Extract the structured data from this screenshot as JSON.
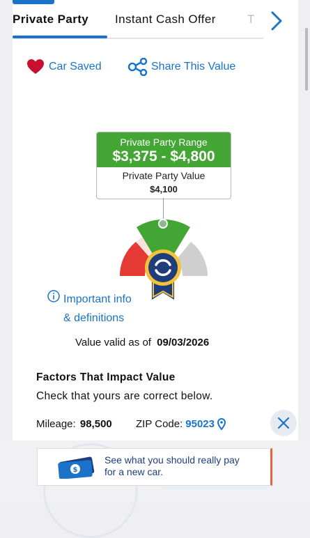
{
  "tabs": {
    "items": [
      "Private Party",
      "Instant Cash Offer",
      "T"
    ],
    "active": "Private Party"
  },
  "actions": {
    "saved_label": "Car Saved",
    "share_label": "Share This Value"
  },
  "range": {
    "title": "Private Party Range",
    "value": "$3,375 - $4,800",
    "sub_label": "Private Party Value",
    "sub_value": "$4,100"
  },
  "info": {
    "line1": "Important info",
    "line2": "& definitions"
  },
  "valid": {
    "label": "Value valid as of",
    "date": "09/03/2026"
  },
  "factors": {
    "title": "Factors That Impact Value",
    "subtitle": "Check that yours are correct below.",
    "mileage_label": "Mileage:",
    "mileage_value": "98,500",
    "zip_label": "ZIP Code:",
    "zip_value": "95023"
  },
  "ad": {
    "line1": "See what you should really pay",
    "line2": "for a new car."
  },
  "colors": {
    "accent": "#1a73c8",
    "green": "#43a534",
    "red": "#e53935",
    "heart": "#c8102e"
  }
}
